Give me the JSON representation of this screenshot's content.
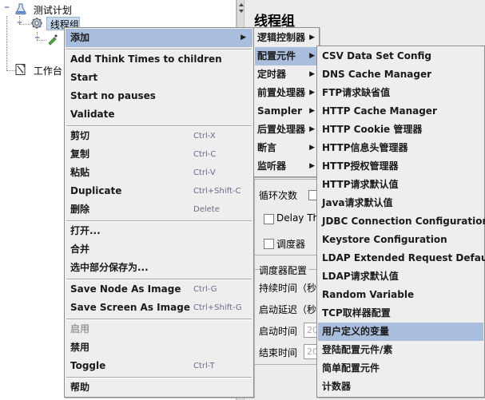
{
  "tree": {
    "test_plan": "测试计划",
    "thread_group": "线程组",
    "workbench": "工作台"
  },
  "right_panel": {
    "title": "线程组",
    "loop_count_label": "循环次数",
    "delay_label": "Delay Thr",
    "scheduler_check_label": "调度器",
    "scheduler_config_label": "调度器配置",
    "duration_label": "持续时间（秒",
    "startup_delay_label": "启动延迟（秒",
    "start_time_label": "启动时间",
    "end_time_label": "结束时间",
    "start_time_value": "20",
    "end_time_value": "20"
  },
  "context_menu": {
    "items": [
      {
        "label": "添加",
        "shortcut": "",
        "submenu": true,
        "highlighted": true
      },
      {
        "label": "Add Think Times to children",
        "shortcut": ""
      },
      {
        "label": "Start",
        "shortcut": ""
      },
      {
        "label": "Start no pauses",
        "shortcut": ""
      },
      {
        "label": "Validate",
        "shortcut": ""
      },
      {
        "label": "剪切",
        "shortcut": "Ctrl-X"
      },
      {
        "label": "复制",
        "shortcut": "Ctrl-C"
      },
      {
        "label": "粘贴",
        "shortcut": "Ctrl-V"
      },
      {
        "label": "Duplicate",
        "shortcut": "Ctrl+Shift-C"
      },
      {
        "label": "删除",
        "shortcut": "Delete"
      },
      {
        "label": "打开...",
        "shortcut": ""
      },
      {
        "label": "合并",
        "shortcut": ""
      },
      {
        "label": "选中部分保存为...",
        "shortcut": ""
      },
      {
        "label": "Save Node As Image",
        "shortcut": "Ctrl-G"
      },
      {
        "label": "Save Screen As Image",
        "shortcut": "Ctrl+Shift-G"
      },
      {
        "label": "启用",
        "shortcut": "",
        "disabled": true
      },
      {
        "label": "禁用",
        "shortcut": ""
      },
      {
        "label": "Toggle",
        "shortcut": "Ctrl-T"
      },
      {
        "label": "帮助",
        "shortcut": ""
      }
    ]
  },
  "add_submenu": {
    "items": [
      {
        "label": "逻辑控制器"
      },
      {
        "label": "配置元件",
        "highlighted": true
      },
      {
        "label": "定时器"
      },
      {
        "label": "前置处理器"
      },
      {
        "label": "Sampler"
      },
      {
        "label": "后置处理器"
      },
      {
        "label": "断言"
      },
      {
        "label": "监听器"
      }
    ]
  },
  "config_submenu": {
    "items": [
      {
        "label": "CSV Data Set Config"
      },
      {
        "label": "DNS Cache Manager"
      },
      {
        "label": "FTP请求缺省值"
      },
      {
        "label": "HTTP Cache Manager"
      },
      {
        "label": "HTTP Cookie 管理器"
      },
      {
        "label": "HTTP信息头管理器"
      },
      {
        "label": "HTTP授权管理器"
      },
      {
        "label": "HTTP请求默认值"
      },
      {
        "label": "Java请求默认值"
      },
      {
        "label": "JDBC Connection Configuration"
      },
      {
        "label": "Keystore Configuration"
      },
      {
        "label": "LDAP Extended Request Defaults"
      },
      {
        "label": "LDAP请求默认值"
      },
      {
        "label": "Random Variable"
      },
      {
        "label": "TCP取样器配置"
      },
      {
        "label": "用户定义的变量",
        "highlighted": true
      },
      {
        "label": "登陆配置元件/素"
      },
      {
        "label": "简单配置元件"
      },
      {
        "label": "计数器"
      }
    ]
  },
  "colors": {
    "highlight": "#a9bedd",
    "menu_bg": "#eeeeee",
    "selection": "#c8d8ec"
  },
  "icons": {
    "submenu_arrow": "▶",
    "collapse": "−"
  }
}
